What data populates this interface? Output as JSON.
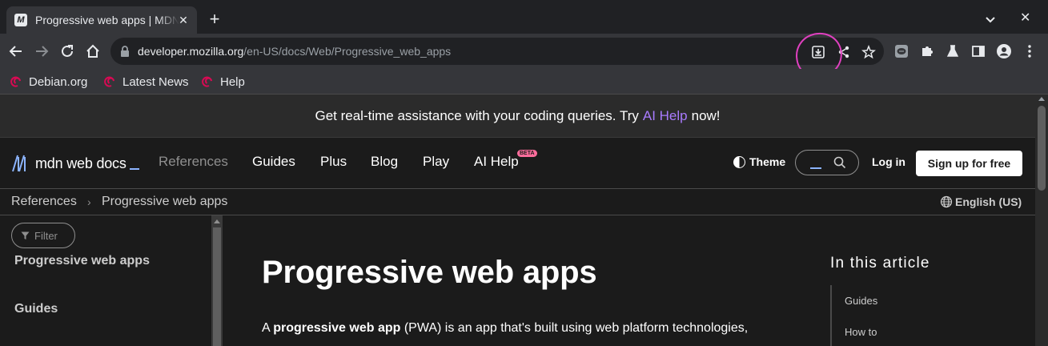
{
  "browser": {
    "tab": {
      "title": "Progressive web apps | MDN",
      "favicon_letter": "M"
    },
    "new_tab_label": "+",
    "window_close_label": "✕",
    "url": {
      "host": "developer.mozilla.org",
      "path": "/en-US/docs/Web/Progressive_web_apps"
    },
    "annotation_color": "#e040c0",
    "bookmarks": [
      {
        "label": "Debian.org"
      },
      {
        "label": "Latest News"
      },
      {
        "label": "Help"
      }
    ]
  },
  "banner": {
    "before": "Get real-time assistance with your coding queries. Try",
    "link": "AI Help",
    "after": "now!"
  },
  "nav": {
    "logo": "mdn web docs",
    "items": [
      "References",
      "Guides",
      "Plus",
      "Blog",
      "Play",
      "AI Help"
    ],
    "beta": "BETA",
    "theme": "Theme",
    "login": "Log in",
    "signup": "Sign up for free"
  },
  "breadcrumb": {
    "items": [
      "References",
      "Progressive web apps"
    ],
    "language": "English (US)"
  },
  "sidebar": {
    "filter_placeholder": "Filter",
    "items": [
      "Progressive web apps",
      "Guides"
    ]
  },
  "article": {
    "title": "Progressive web apps",
    "lead_prefix": "A ",
    "lead_bold": "progressive web app",
    "lead_rest": " (PWA) is an app that's built using web platform technologies,"
  },
  "toc": {
    "title": "In this article",
    "items": [
      "Guides",
      "How to"
    ]
  },
  "colors": {
    "accent": "#a97bff",
    "beta": "#ff6d9c",
    "logo_blue": "#8cb4ff"
  }
}
